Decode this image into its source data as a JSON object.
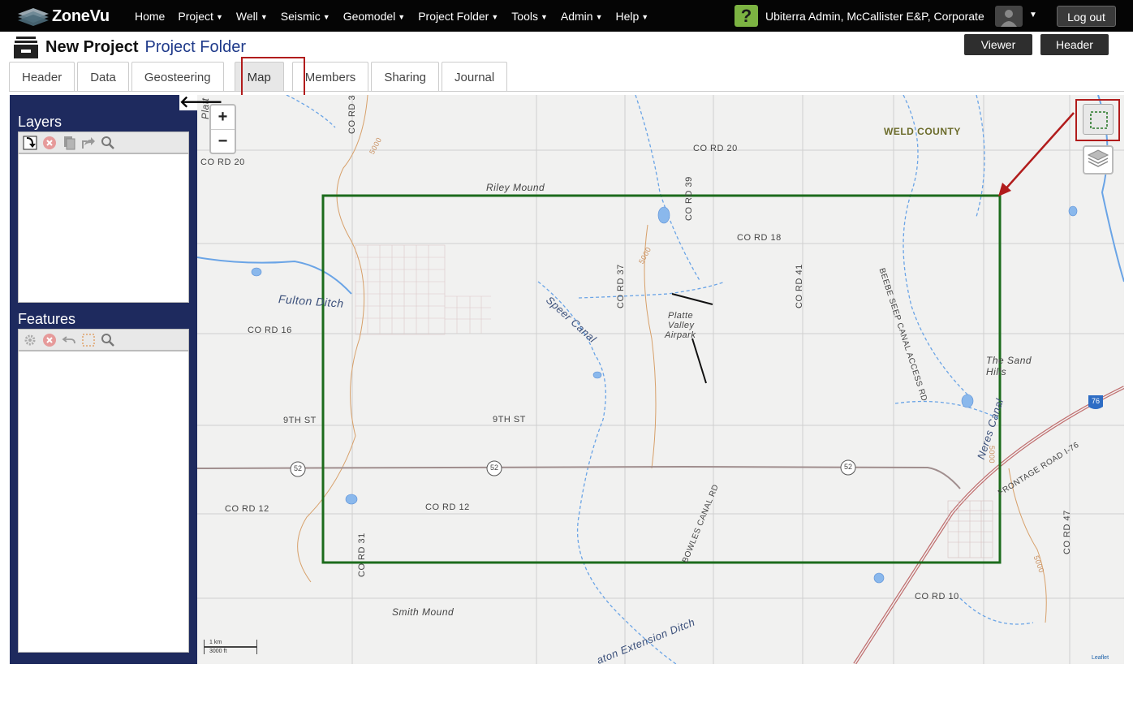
{
  "app": {
    "logo_text": "ZoneVu"
  },
  "nav": {
    "items": [
      {
        "label": "Home",
        "caret": false
      },
      {
        "label": "Project",
        "caret": true
      },
      {
        "label": "Well",
        "caret": true
      },
      {
        "label": "Seismic",
        "caret": true
      },
      {
        "label": "Geomodel",
        "caret": true
      },
      {
        "label": "Project Folder",
        "caret": true
      },
      {
        "label": "Tools",
        "caret": true
      },
      {
        "label": "Admin",
        "caret": true
      },
      {
        "label": "Help",
        "caret": true
      }
    ],
    "help_badge": "?",
    "user": "Ubiterra Admin, McCallister E&P, Corporate",
    "logout_label": "Log out"
  },
  "project": {
    "name": "New Project",
    "folder": "Project Folder",
    "viewer_button": "Viewer",
    "header_button": "Header"
  },
  "tabs": [
    "Header",
    "Data",
    "Geosteering",
    "Map",
    "Members",
    "Sharing",
    "Journal"
  ],
  "active_tab": "Map",
  "sidebar": {
    "layers_title": "Layers",
    "features_title": "Features"
  },
  "map": {
    "zoom_in": "+",
    "zoom_out": "−",
    "back_arrow": "🡐",
    "scale_km": "1 km",
    "scale_ft": "3000 ft",
    "attribution": "Leaflet",
    "labels": {
      "weld_county": "WELD COUNTY",
      "co_rd_20_a": "CO RD 20",
      "co_rd_20_b": "CO RD 20",
      "riley_mound": "Riley Mound",
      "co_rd_39": "CO RD 39",
      "co_rd_18": "CO RD 18",
      "co_rd_37": "CO RD 37",
      "co_rd_41": "CO RD 41",
      "beebe": "BEEBE SEEP CANAL ACCESS RD",
      "fulton_ditch": "Fulton Ditch",
      "speer_canal": "Speer Canal",
      "platte_valley": "Platte",
      "platte_valley2": "Valley",
      "airpark": "Airpark",
      "co_rd_16": "CO RD 16",
      "sand_hills": "The Sand",
      "sand_hills2": "Hills",
      "neres_canal": "Neres Canal",
      "ninth_st_a": "9TH ST",
      "ninth_st_b": "9TH ST",
      "hwy_52_a": "52",
      "hwy_52_b": "52",
      "hwy_52_c": "52",
      "i76": "76",
      "frontage": "FRONTAGE ROAD I-76",
      "co_rd_12_a": "CO RD 12",
      "co_rd_12_b": "CO RD 12",
      "co_rd_31": "CO RD 31",
      "bowles": "BOWLES CANAL RD",
      "co_rd_10": "CO RD 10",
      "co_rd_47": "CO RD 47",
      "smith_mound": "Smith Mound",
      "extension_ditch": "aton Extension Ditch",
      "contour_5000_a": "5000",
      "contour_5000_b": "5000",
      "contour_5000_c": "5000",
      "contour_5000_d": "5000",
      "co_rd_3": "CO RD 3",
      "platte_top": "Platt"
    }
  },
  "colors": {
    "nav_bg": "#050505",
    "sidebar_bg": "#1e2a5e",
    "selection_rect": "#1c6b1c",
    "highlight": "#b11c1c",
    "water": "#4a90e2",
    "road": "#8a7070"
  }
}
